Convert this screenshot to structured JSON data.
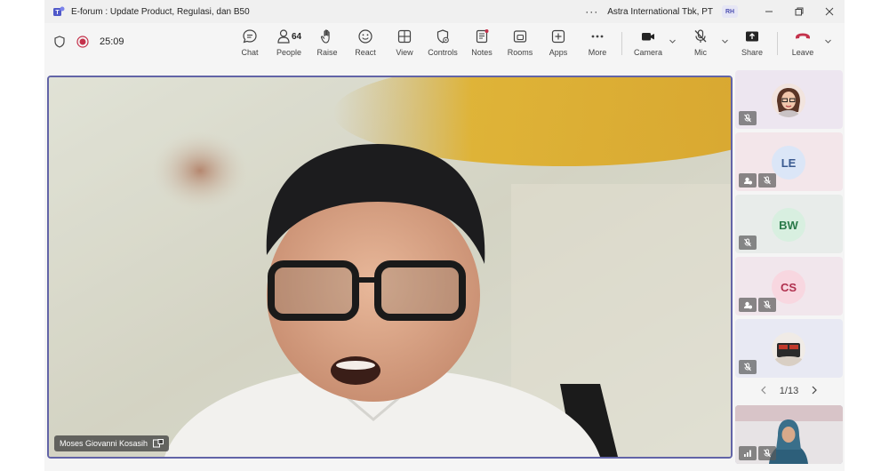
{
  "titlebar": {
    "title": "E-forum : Update Product, Regulasi, dan B50",
    "org": "Astra International Tbk, PT",
    "user_initials": "RH",
    "more": "···"
  },
  "toolbar": {
    "timer": "25:09",
    "people_count": "64",
    "buttons": {
      "chat": "Chat",
      "people": "People",
      "raise": "Raise",
      "react": "React",
      "view": "View",
      "controls": "Controls",
      "notes": "Notes",
      "rooms": "Rooms",
      "apps": "Apps",
      "more": "More",
      "camera": "Camera",
      "mic": "Mic",
      "share": "Share",
      "leave": "Leave"
    }
  },
  "main_video": {
    "speaker_name": "Moses Giovanni Kosasih"
  },
  "participants": [
    {
      "initials": "",
      "type": "photo",
      "bg": "#ede6f0",
      "muted": true,
      "hand": false
    },
    {
      "initials": "LE",
      "type": "initials",
      "bg": "#f3e6ea",
      "avatar_bg": "#dbe6f7",
      "avatar_fg": "#3a5a90",
      "muted": true,
      "hand": true
    },
    {
      "initials": "BW",
      "type": "initials",
      "bg": "#e8ecea",
      "avatar_bg": "#d8efe0",
      "avatar_fg": "#2a7a4a",
      "muted": true,
      "hand": false
    },
    {
      "initials": "CS",
      "type": "initials",
      "bg": "#f1e6ec",
      "avatar_bg": "#f8d7e0",
      "avatar_fg": "#b0304e",
      "muted": true,
      "hand": true
    },
    {
      "initials": "",
      "type": "photo",
      "bg": "#e8e9f3",
      "muted": true,
      "hand": false
    }
  ],
  "pager": {
    "label": "1/13"
  },
  "colors": {
    "accent": "#6264a7",
    "leave": "#c4314b",
    "record": "#c4314b"
  }
}
